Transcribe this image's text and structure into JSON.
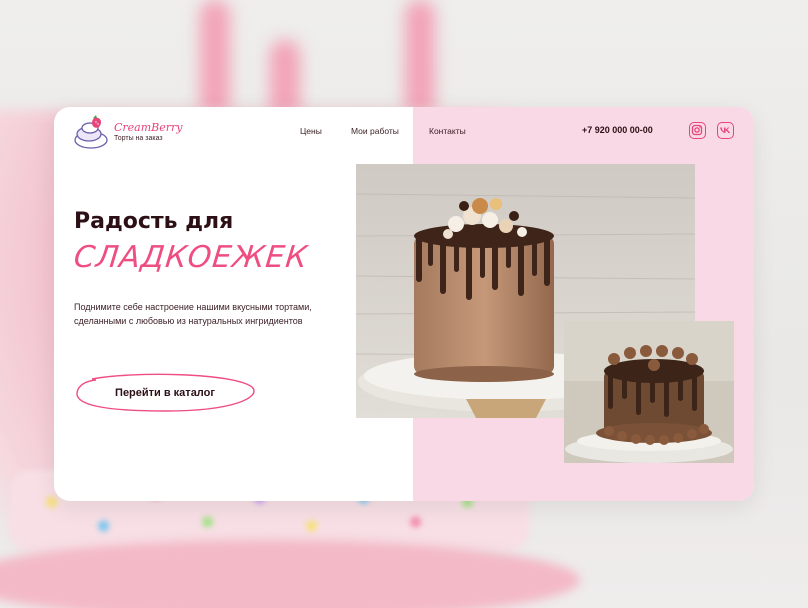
{
  "brand": {
    "name": "CreamBerry",
    "tagline": "Торты на заказ"
  },
  "nav": {
    "items": [
      {
        "label": "Цены"
      },
      {
        "label": "Мои работы"
      },
      {
        "label": "Контакты"
      }
    ]
  },
  "contact": {
    "phone": "+7 920 000 00-00"
  },
  "social": {
    "items": [
      {
        "icon": "instagram-icon"
      },
      {
        "icon": "vk-icon"
      }
    ]
  },
  "hero": {
    "title": "Радость для",
    "accent": "СЛАДКОЕЖЕК",
    "description": "Поднимите себе настроение нашими вкусными тортами, сделанными с любовью из натуральных ингридиентов",
    "cta_label": "Перейти в каталог"
  },
  "colors": {
    "accent": "#ee4e82",
    "dark": "#2c1015",
    "pink_panel": "#f9d9e5"
  },
  "images": {
    "main": "chocolate-drip-cake-photo",
    "secondary": "chocolate-cream-cake-photo"
  }
}
